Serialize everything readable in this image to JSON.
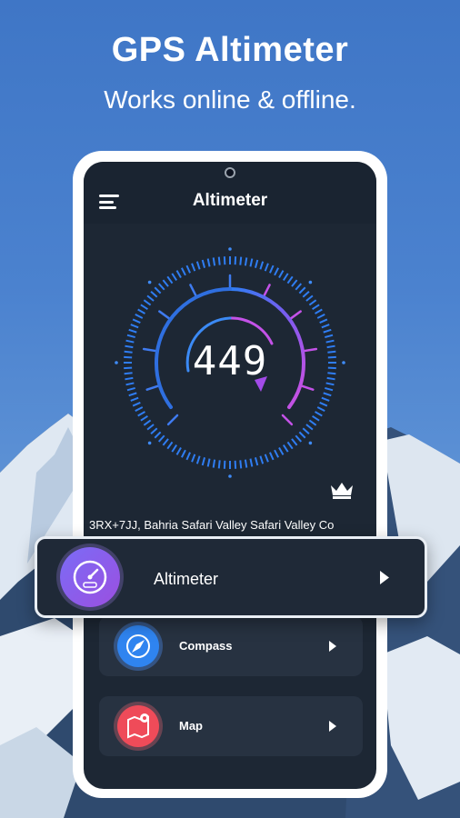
{
  "promo": {
    "title": "GPS Altimeter",
    "subtitle": "Works online & offline."
  },
  "app": {
    "title": "Altimeter",
    "altitude_reading": "449",
    "address": "3RX+7JJ, Bahria Safari Valley Safari Valley Co"
  },
  "menu": [
    {
      "label": "Altimeter",
      "icon": "speedometer-icon"
    },
    {
      "label": "Compass",
      "icon": "compass-icon"
    },
    {
      "label": "Map",
      "icon": "map-icon"
    }
  ],
  "colors": {
    "background": "#4b82cf",
    "screen": "#1d2734",
    "gauge_blue": "#2f7df2",
    "gauge_purple": "#a44bf0",
    "compass_blue": "#2f84f0",
    "map_red": "#ef4b59"
  }
}
